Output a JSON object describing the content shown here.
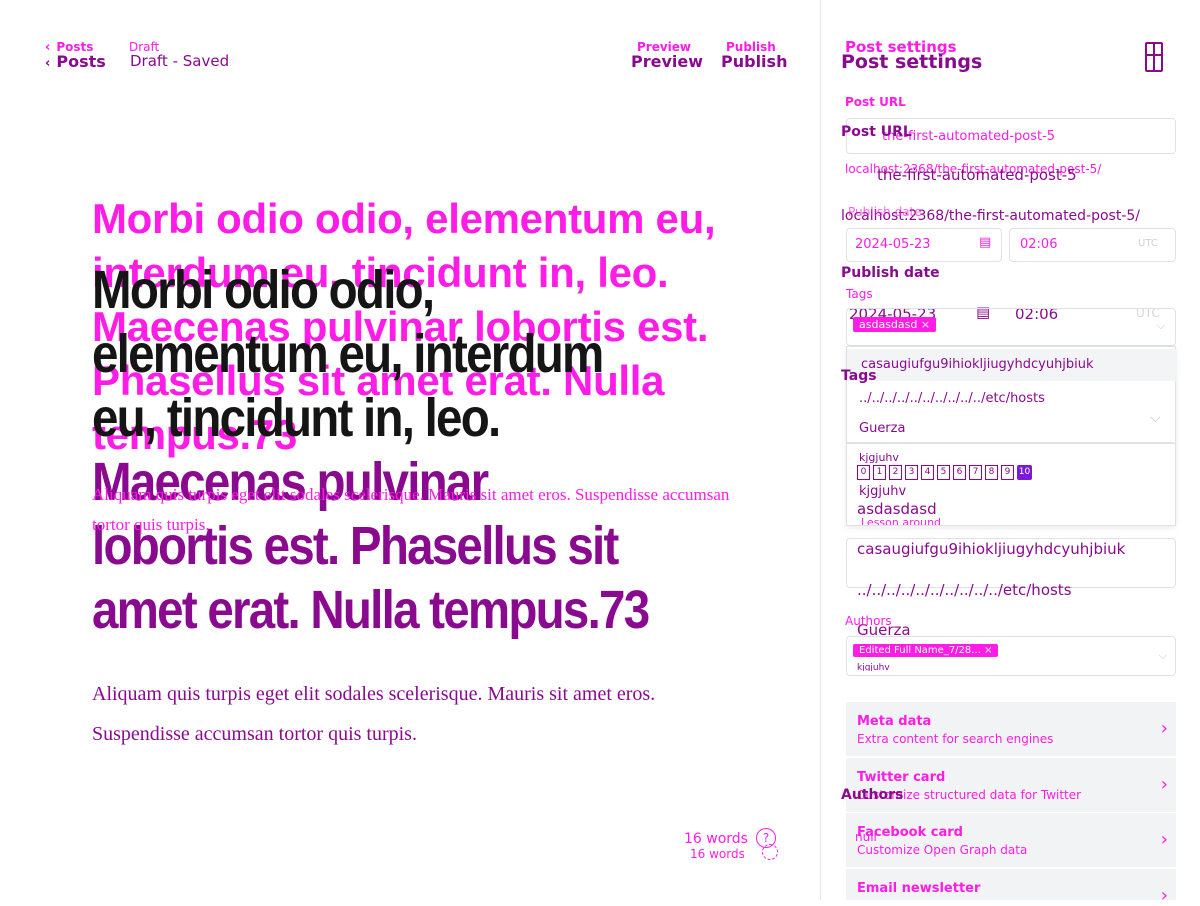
{
  "topbar": {
    "back_label": "Posts",
    "status_small": "Draft",
    "status_big": "Draft - Saved",
    "preview_label": "Preview",
    "publish_label": "Publish"
  },
  "editor": {
    "title_ghost": "Morbi odio odio, elementum eu, interdum eu, tincidunt in, leo. Maecenas pulvinar lobortis est. Phasellus sit amet erat. Nulla tempus.73",
    "title_main_dark": "Morbi odio odio, elementum eu, interdum eu, tincidunt in, leo.",
    "title_main_rest": "Maecenas pulvinar lobortis est. Phasellus sit amet erat. Nulla tempus.73",
    "excerpt_ghost": "Aliquam quis turpis eget elit sodales scelerisque. Mauris sit amet eros. Suspendisse accumsan tortor quis turpis.",
    "excerpt_main": "Aliquam quis turpis eget elit sodales scelerisque. Mauris sit amet eros. Suspendisse accumsan tortor quis turpis.",
    "word_count_big": "16 words",
    "word_count_small": "16 words",
    "help_glyph": "?"
  },
  "settings": {
    "title_small": "Post settings",
    "title_big": "Post settings",
    "post_url_label_small": "Post URL",
    "post_url_label_big": "Post URL",
    "post_url_value": "the-first-automated-post-5",
    "post_url_value_big": "the-first-automated-post-5",
    "url_hint_small": "localhost:2368/the-first-automated-post-5/",
    "url_hint_big": "localhost:2368/the-first-automated-post-5/",
    "publish_date_label_small": "Publish date",
    "publish_date_label_big": "Publish date",
    "date_value": "2024-05-23",
    "time_value": "02:06",
    "date_value_big": "2024-05-23",
    "time_value_big": "02:06",
    "timezone": "UTC",
    "tags_label_small": "Tags",
    "tags_label_big": "Tags",
    "tag_chip": "asdasdasd",
    "tag_options": [
      "casaugiufgu9ihiokljiugyhdcyuhjbiuk",
      "../../../../../../../../../../etc/hosts",
      "Guerza",
      "kjgjuhv",
      "kjgjuhv"
    ],
    "number_badges": [
      "0",
      "1",
      "2",
      "3",
      "4",
      "5",
      "6",
      "7",
      "8",
      "9",
      "10"
    ],
    "selected_badge": "10",
    "under_dropdown_tags": [
      "asdasdasd",
      "casaugiufgu9ihiokljiugyhdcyuhjbiuk",
      "../../../../../../../../../../etc/hosts",
      "Guerza"
    ],
    "partial_item": "Lesson around",
    "authors_label_small": "Authors",
    "authors_label_big": "Authors",
    "author_chip": "Edited Full Name_7/28...",
    "author_partial": "kjgjuhv",
    "null_text": "null",
    "cards": [
      {
        "title": "Meta data",
        "subtitle": "Extra content for search engines"
      },
      {
        "title": "Twitter card",
        "subtitle": "Customize structured data for Twitter"
      },
      {
        "title": "Facebook card",
        "subtitle": "Customize Open Graph data"
      },
      {
        "title": "Email newsletter",
        "subtitle": ""
      }
    ]
  }
}
